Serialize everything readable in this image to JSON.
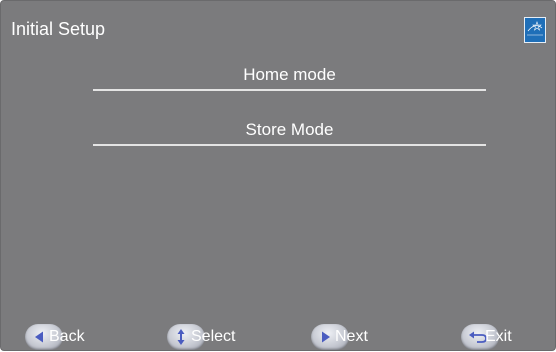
{
  "header": {
    "title": "Initial Setup",
    "logo_icon": "energy-star-logo"
  },
  "menu": {
    "items": [
      {
        "label": "Home mode"
      },
      {
        "label": "Store Mode"
      }
    ]
  },
  "footer": {
    "hints": [
      {
        "label": "Back",
        "icon": "arrow-left-icon"
      },
      {
        "label": "Select",
        "icon": "arrow-up-down-icon"
      },
      {
        "label": "Next",
        "icon": "arrow-right-icon"
      },
      {
        "label": "Exit",
        "icon": "return-icon"
      }
    ]
  },
  "colors": {
    "background": "#7b7b7d",
    "text": "#ffffff",
    "divider": "#e4e4e4",
    "logo": "#1f6fb8"
  }
}
